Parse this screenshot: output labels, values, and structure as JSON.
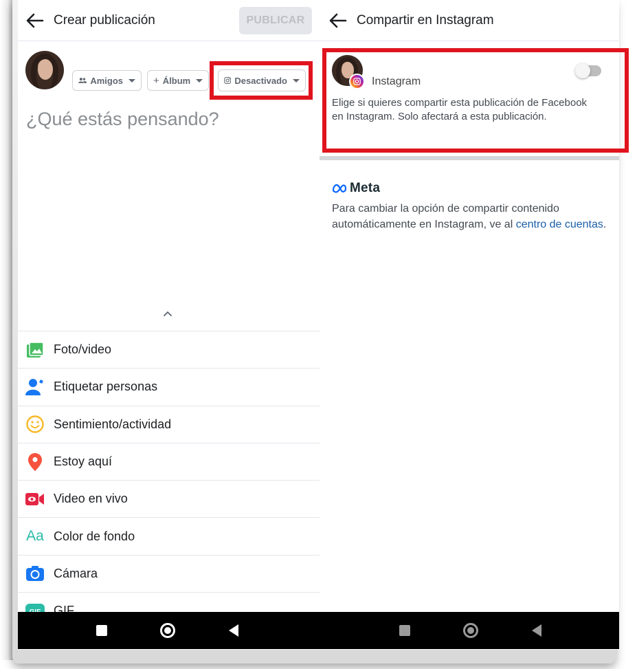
{
  "left_screen": {
    "title": "Crear publicación",
    "publish_button": "PUBLICAR",
    "pills": {
      "audience": "Amigos",
      "album": "Álbum",
      "instagram": "Desactivado"
    },
    "composer_placeholder": "¿Qué estás pensando?",
    "actions": [
      {
        "label": "Foto/video",
        "icon": "photo-video-icon",
        "color": "#45bd62"
      },
      {
        "label": "Etiquetar personas",
        "icon": "tag-people-icon",
        "color": "#1877f2"
      },
      {
        "label": "Sentimiento/actividad",
        "icon": "feeling-icon",
        "color": "#f7b928"
      },
      {
        "label": "Estoy aquí",
        "icon": "location-pin-icon",
        "color": "#f5533d"
      },
      {
        "label": "Video en vivo",
        "icon": "live-video-icon",
        "color": "#e42645"
      },
      {
        "label": "Color de fondo",
        "icon": "background-color-icon",
        "color": "#2abba7"
      },
      {
        "label": "Cámara",
        "icon": "camera-icon",
        "color": "#1877f2"
      },
      {
        "label": "GIF",
        "icon": "gif-icon",
        "color": "#2abba7"
      }
    ]
  },
  "right_screen": {
    "title": "Compartir en Instagram",
    "instagram_label": "Instagram",
    "toggle_on": false,
    "description": "Elige si quieres compartir esta publicación de Facebook en Instagram. Solo afectará a esta publicación.",
    "meta_brand": "Meta",
    "meta_text_before": "Para cambiar la opción de compartir contenido automáticamente en Instagram, ve al ",
    "meta_link": "centro de cuentas",
    "meta_text_after": "."
  },
  "colors": {
    "highlight": "#e0141e",
    "link": "#1a5ea8"
  }
}
